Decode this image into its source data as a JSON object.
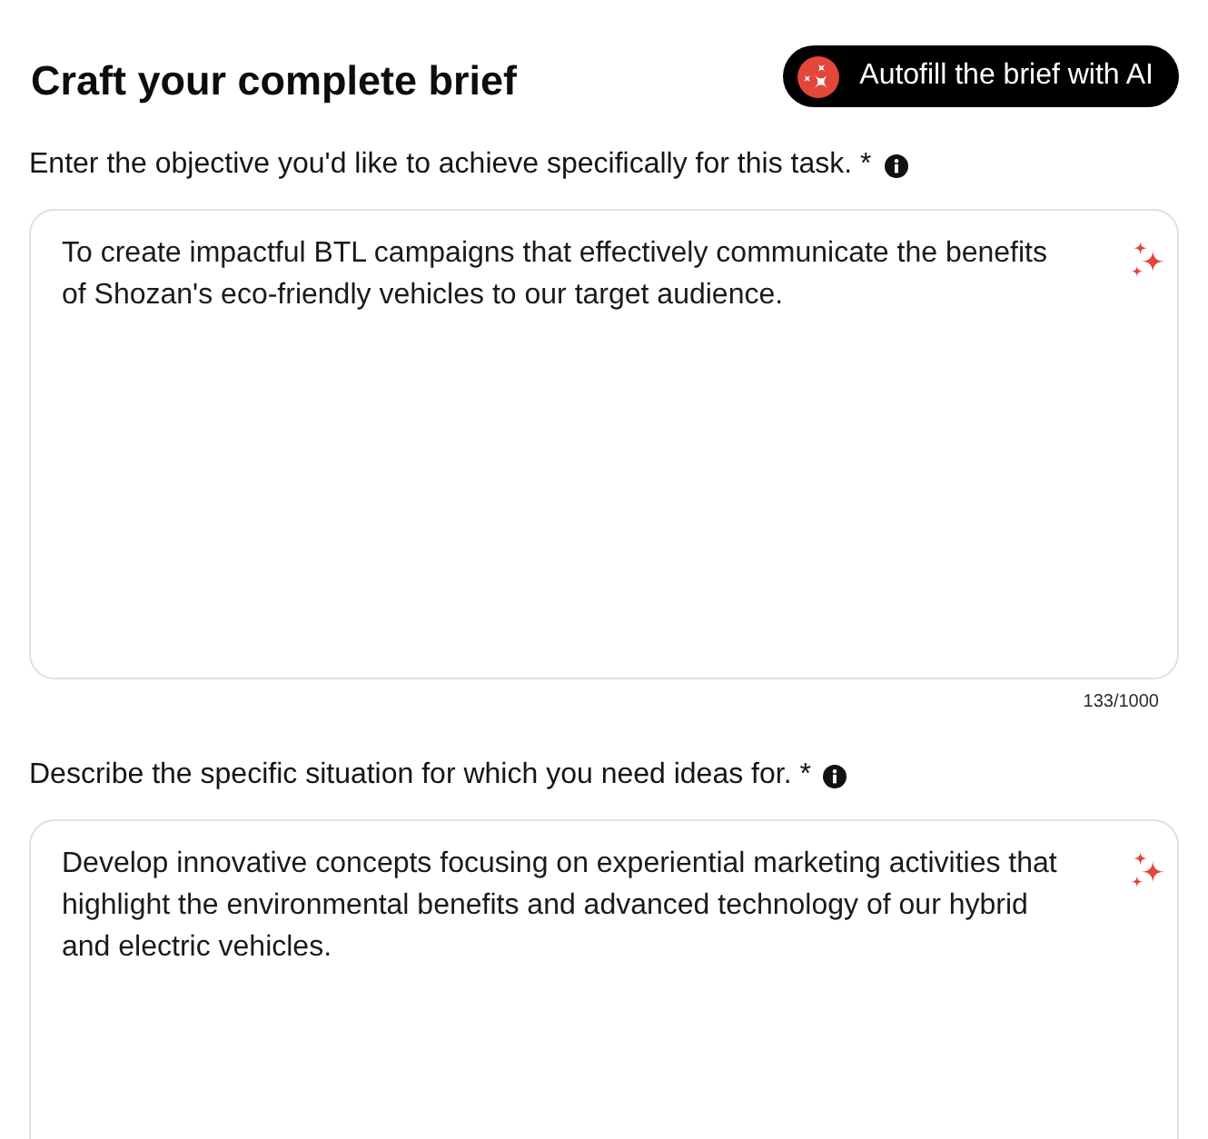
{
  "header": {
    "title": "Craft your complete brief",
    "autofill_button": "Autofill the brief with AI"
  },
  "fields": [
    {
      "label": "Enter the objective you'd like to achieve specifically for this task. *",
      "value": "To create impactful BTL campaigns that effectively communicate the benefits of Shozan's eco-friendly vehicles to our target audience.",
      "counter": "133/1000"
    },
    {
      "label": "Describe the specific situation for which you need ideas for. *",
      "value": "Develop innovative concepts focusing on experiential marketing activities that highlight the environmental benefits and advanced technology of our hybrid and electric vehicles."
    }
  ]
}
